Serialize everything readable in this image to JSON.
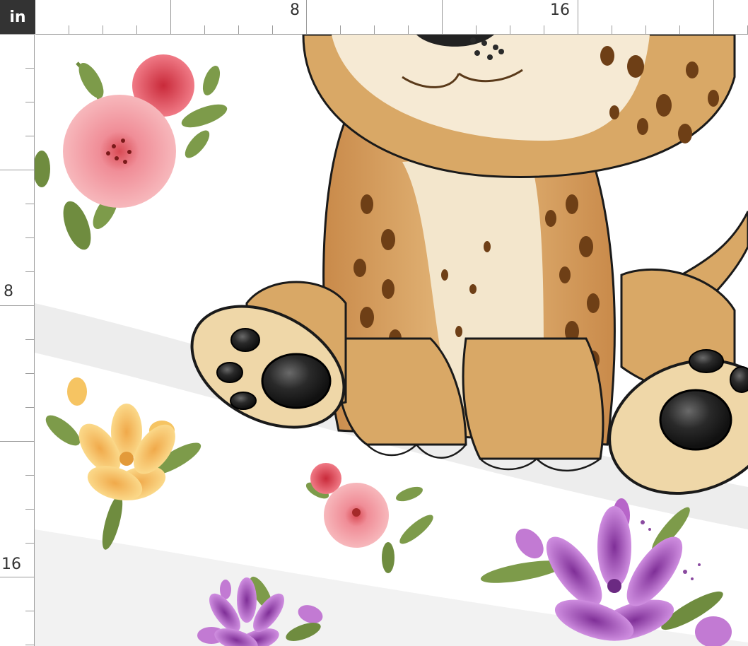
{
  "ruler": {
    "unit": "in",
    "top_labels": [
      "8",
      "16"
    ],
    "left_labels": [
      "8",
      "16"
    ]
  },
  "artwork": {
    "subject": "leopard-cub",
    "flowers": [
      "pink-rose",
      "yellow-lily",
      "pink-rose-small",
      "purple-lily",
      "purple-lily-small"
    ]
  },
  "colors": {
    "ruler_badge": "#333333",
    "ruler_line": "#9a9a9a",
    "fur": "#d9a866",
    "fur_light": "#f3e6cc",
    "spot": "#6e3f16",
    "rose": "#ec8f98",
    "lily_yellow": "#f6c462",
    "lily_purple": "#b765c9",
    "leaf": "#6f8c3f",
    "paw_pad": "#1c1c1c"
  }
}
